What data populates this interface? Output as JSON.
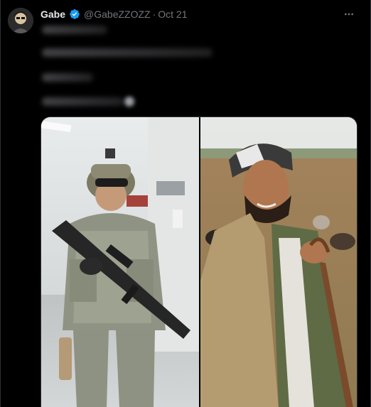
{
  "tweet": {
    "author_name": "Gabe",
    "author_handle": "@GabeZZOZZ",
    "separator": "·",
    "timestamp": "Oct 21",
    "verified": true
  },
  "icons": {
    "avatar": "avatar-image",
    "verified": "verified-badge-icon",
    "more": "more-options-icon",
    "blurred_emoji": "blurred-emoji"
  },
  "colors": {
    "background": "#000000",
    "text_primary": "#e7e9ea",
    "text_secondary": "#71767b",
    "verified_blue": "#1d9bf0",
    "border": "#2f3336"
  },
  "media": {
    "images": [
      {
        "name": "soldier-photo"
      },
      {
        "name": "tribesman-photo"
      }
    ]
  }
}
